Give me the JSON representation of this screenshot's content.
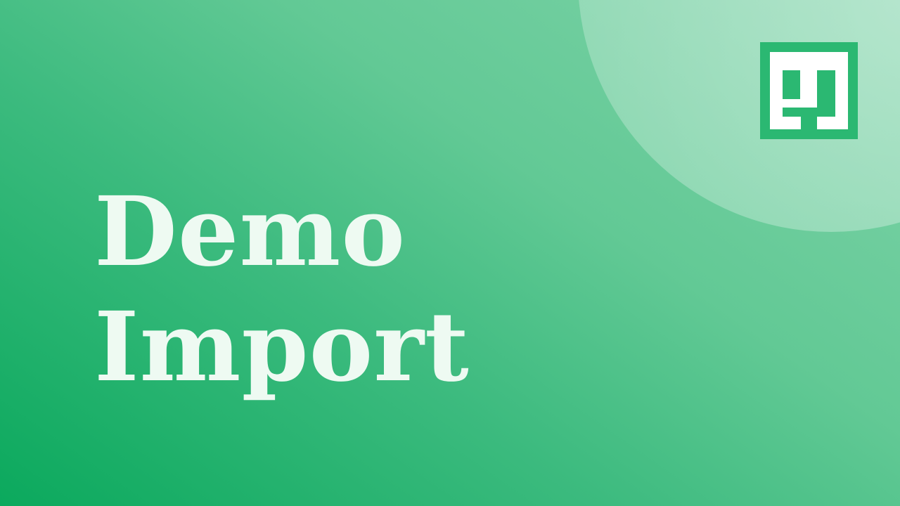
{
  "title": {
    "line1": "Demo",
    "line2": "Import"
  },
  "logo": {
    "icon": "brand-logo-icon"
  },
  "colors": {
    "background_start": "#0ba95d",
    "background_end": "#7fd3a9",
    "text": "#eefaf2",
    "logo_fill": "#2bb872",
    "logo_mark": "#ffffff"
  }
}
